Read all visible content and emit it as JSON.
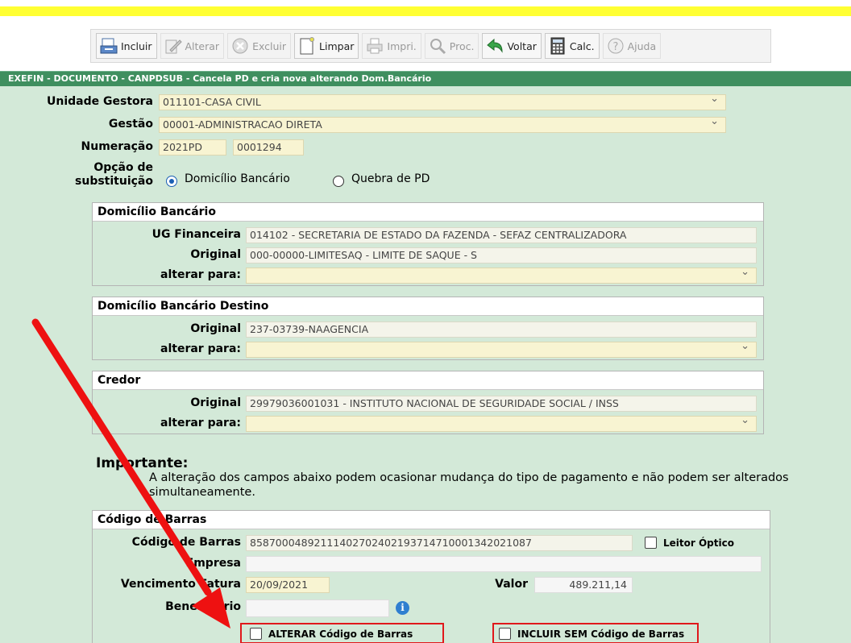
{
  "toolbar": {
    "buttons": [
      {
        "label": "Incluir",
        "icon": "add-document-icon",
        "enabled": true
      },
      {
        "label": "Alterar",
        "icon": "edit-icon",
        "enabled": false
      },
      {
        "label": "Excluir",
        "icon": "delete-icon",
        "enabled": false
      },
      {
        "label": "Limpar",
        "icon": "clear-icon",
        "enabled": true
      },
      {
        "label": "Impri.",
        "icon": "print-icon",
        "enabled": false
      },
      {
        "label": "Proc.",
        "icon": "search-icon",
        "enabled": false
      },
      {
        "label": "Voltar",
        "icon": "back-arrow-icon",
        "enabled": true
      },
      {
        "label": "Calc.",
        "icon": "calculator-icon",
        "enabled": true
      },
      {
        "label": "Ajuda",
        "icon": "help-icon",
        "enabled": false
      }
    ]
  },
  "title": "EXEFIN - DOCUMENTO - CANPDSUB - Cancela PD e cria nova alterando Dom.Bancário",
  "form": {
    "unidade_gestora_label": "Unidade Gestora",
    "unidade_gestora_value": "011101-CASA CIVIL",
    "gestao_label": "Gestão",
    "gestao_value": "00001-ADMINISTRACAO DIRETA",
    "numeracao_label": "Numeração",
    "numeracao_ano": "2021PD",
    "numeracao_numero": "0001294",
    "opcao_label_1": "Opção de",
    "opcao_label_2": "substituição",
    "opcao_domicilio": "Domicílio Bancário",
    "opcao_quebra": "Quebra de PD",
    "opcao_selected": "Domicílio Bancário"
  },
  "domicilio": {
    "header": "Domicílio Bancário",
    "ug_label": "UG Financeira",
    "ug_value": "014102 - SECRETARIA DE ESTADO DA FAZENDA - SEFAZ  CENTRALIZADORA",
    "original_label": "Original",
    "original_value": "000-00000-LIMITESAQ - LIMITE DE SAQUE - S",
    "alterar_label": "alterar para:",
    "alterar_value": ""
  },
  "destino": {
    "header": "Domicílio Bancário Destino",
    "original_label": "Original",
    "original_value": "237-03739-NAAGENCIA",
    "alterar_label": "alterar para:",
    "alterar_value": ""
  },
  "credor": {
    "header": "Credor",
    "original_label": "Original",
    "original_value": "29979036001031 - INSTITUTO NACIONAL DE SEGURIDADE SOCIAL / INSS",
    "alterar_label": "alterar para:",
    "alterar_value": ""
  },
  "importante": {
    "title": "Importante:",
    "text": "A alteração dos campos abaixo podem ocasionar mudança do tipo de pagamento e não podem ser alterados simultaneamente."
  },
  "barras": {
    "header": "Código de Barras",
    "codigo_label": "Código de Barras",
    "codigo_value": "85870004892111402702402193714710001342021087",
    "leitor_label": "Leitor Óptico",
    "empresa_label": "Empresa",
    "empresa_value": "",
    "vencimento_label": "Vencimento Fatura",
    "vencimento_value": "20/09/2021",
    "valor_label": "Valor",
    "valor_value": "489.211,14",
    "beneficiario_label": "Beneficiário",
    "beneficiario_value": "",
    "alterar_codigo_label": "ALTERAR Código de Barras",
    "incluir_sem_label": "INCLUIR SEM Código de Barras"
  },
  "colors": {
    "title_bar": "#3f8f5f",
    "background": "#d3e9d8",
    "field": "#f8f4d2",
    "highlight": "#e0181b"
  }
}
